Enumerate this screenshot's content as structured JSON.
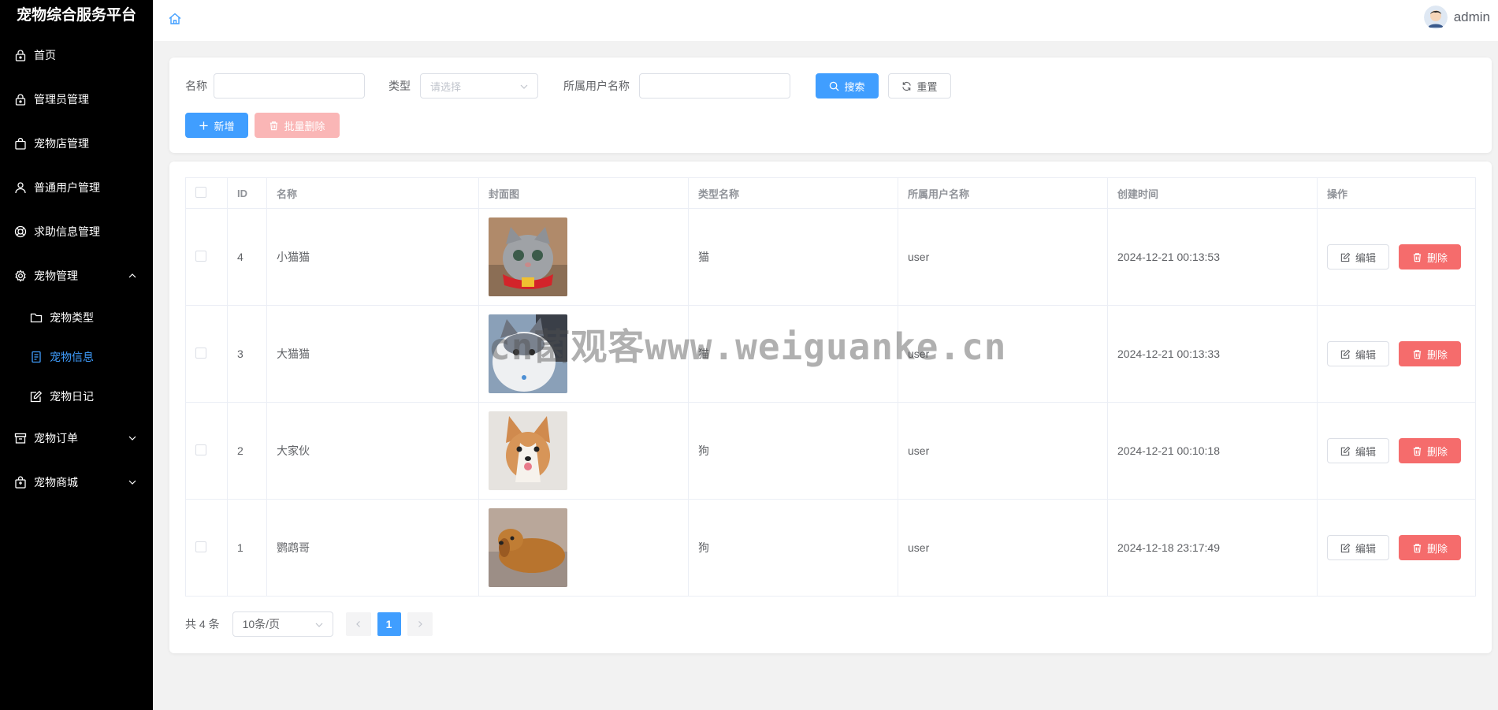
{
  "app": {
    "title": "宠物综合服务平台"
  },
  "sidebar": {
    "items": [
      {
        "label": "首页",
        "icon": "lock-icon"
      },
      {
        "label": "管理员管理",
        "icon": "lock-icon"
      },
      {
        "label": "宠物店管理",
        "icon": "bag-icon"
      },
      {
        "label": "普通用户管理",
        "icon": "user-icon"
      },
      {
        "label": "求助信息管理",
        "icon": "lifebuoy-icon"
      },
      {
        "label": "宠物管理",
        "icon": "gear-icon",
        "expanded": true,
        "children": [
          {
            "label": "宠物类型",
            "icon": "folder-icon"
          },
          {
            "label": "宠物信息",
            "icon": "document-icon",
            "active": true
          },
          {
            "label": "宠物日记",
            "icon": "edit-icon"
          }
        ]
      },
      {
        "label": "宠物订单",
        "icon": "box-icon",
        "expanded": false
      },
      {
        "label": "宠物商城",
        "icon": "shop-icon",
        "expanded": false
      }
    ]
  },
  "header": {
    "username": "admin"
  },
  "search": {
    "name_label": "名称",
    "name_value": "",
    "type_label": "类型",
    "type_placeholder": "请选择",
    "owner_label": "所属用户名称",
    "owner_value": "",
    "search_btn": "搜索",
    "reset_btn": "重置"
  },
  "actions": {
    "add_btn": "新增",
    "batch_delete_btn": "批量删除"
  },
  "table": {
    "columns": [
      "ID",
      "名称",
      "封面图",
      "类型名称",
      "所属用户名称",
      "创建时间",
      "操作"
    ],
    "edit_label": "编辑",
    "delete_label": "删除",
    "rows": [
      {
        "id": "4",
        "name": "小猫猫",
        "type": "猫",
        "owner": "user",
        "created": "2024-12-21 00:13:53",
        "cover": "cat-gray"
      },
      {
        "id": "3",
        "name": "大猫猫",
        "type": "猫",
        "owner": "user",
        "created": "2024-12-21 00:13:33",
        "cover": "cat-white"
      },
      {
        "id": "2",
        "name": "大家伙",
        "type": "狗",
        "owner": "user",
        "created": "2024-12-21 00:10:18",
        "cover": "dog-corgi"
      },
      {
        "id": "1",
        "name": "鹦鹉哥",
        "type": "狗",
        "owner": "user",
        "created": "2024-12-18 23:17:49",
        "cover": "dog-golden"
      }
    ]
  },
  "pagination": {
    "total": "共 4 条",
    "page_size": "10条/页",
    "current_page": "1"
  },
  "watermark": "cn菌观客www.weiguanke.cn",
  "colors": {
    "primary": "#409eff",
    "danger": "#f56c6c",
    "sidebar_bg": "#000000"
  }
}
